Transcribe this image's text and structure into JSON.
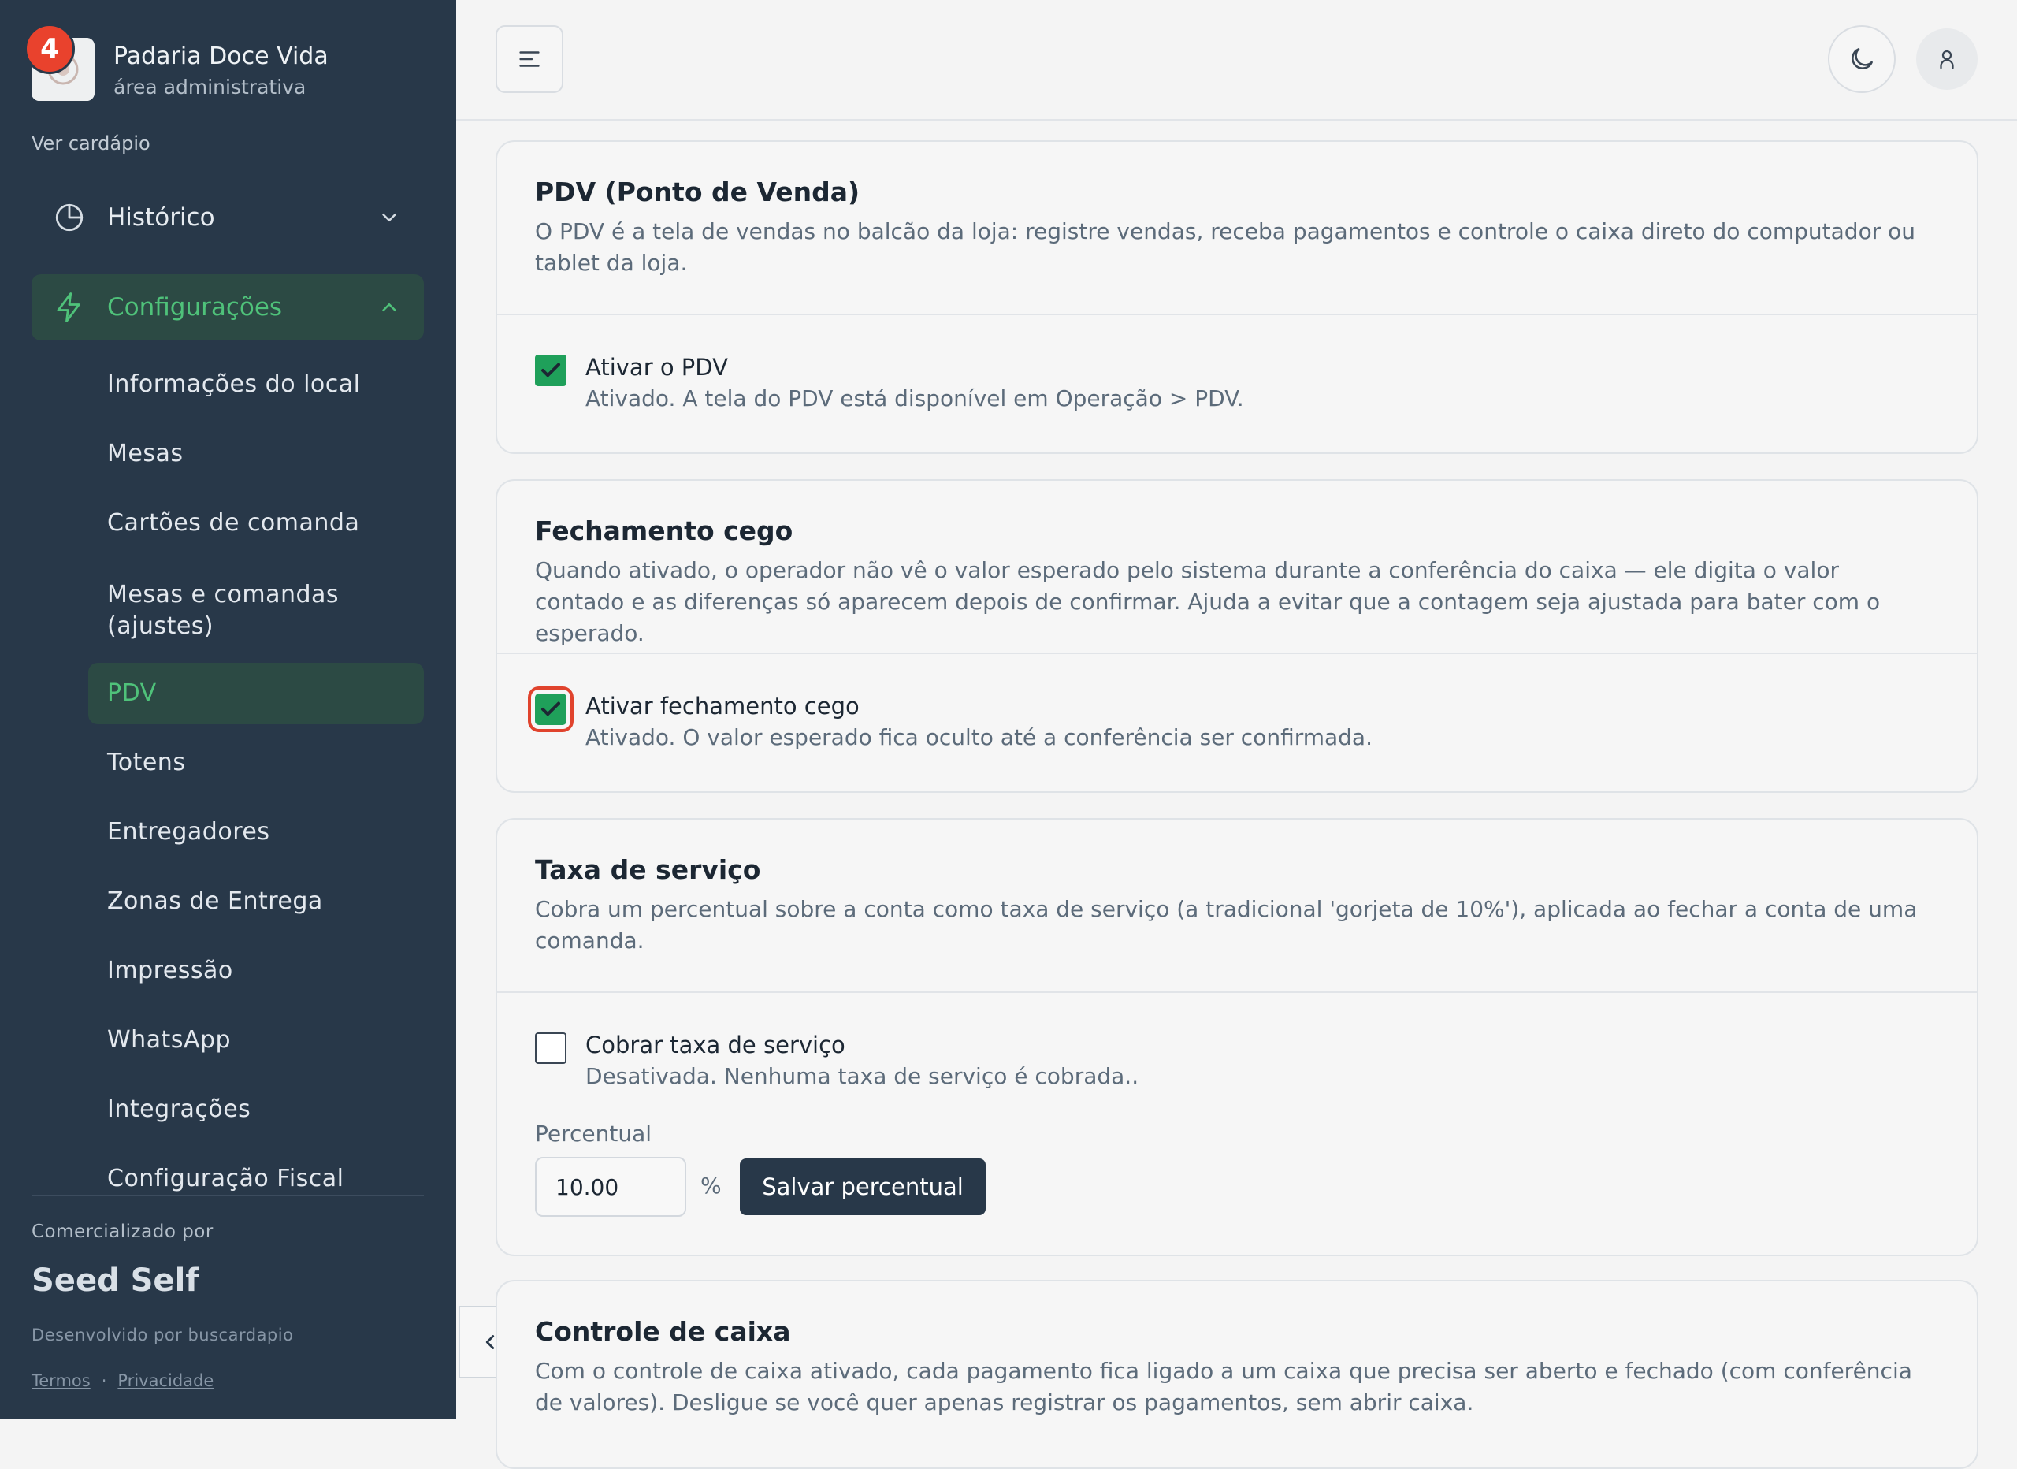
{
  "sidebar": {
    "brand_name": "Padaria Doce Vida",
    "brand_subtitle": "área administrativa",
    "notification_count": "4",
    "view_menu_link": "Ver cardápio",
    "groups": {
      "history": "Histórico",
      "settings": "Configurações"
    },
    "items": [
      "Informações do local",
      "Mesas",
      "Cartões de comanda",
      "Mesas e comandas (ajustes)",
      "PDV",
      "Totens",
      "Entregadores",
      "Zonas de Entrega",
      "Impressão",
      "WhatsApp",
      "Integrações",
      "Configuração Fiscal"
    ],
    "active_item": "PDV",
    "powered_by": "Comercializado por",
    "product": "Seed Self",
    "developed_by": "Desenvolvido por buscardapio",
    "terms": "Termos",
    "separator": "·",
    "privacy": "Privacidade"
  },
  "cards": {
    "pdv": {
      "title": "PDV (Ponto de Venda)",
      "description": "O PDV é a tela de vendas no balcão da loja: registre vendas, receba pagamentos e controle o caixa direto do computador ou tablet da loja.",
      "option_label": "Ativar o PDV",
      "option_desc": "Ativado. A tela do PDV está disponível em Operação > PDV.",
      "checked": true
    },
    "blind": {
      "title": "Fechamento cego",
      "description": "Quando ativado, o operador não vê o valor esperado pelo sistema durante a conferência do caixa — ele digita o valor contado e as diferenças só aparecem depois de confirmar. Ajuda a evitar que a contagem seja ajustada para bater com o esperado.",
      "option_label": "Ativar fechamento cego",
      "option_desc": "Ativado. O valor esperado fica oculto até a conferência ser confirmada.",
      "checked": true
    },
    "service": {
      "title": "Taxa de serviço",
      "description": "Cobra um percentual sobre a conta como taxa de serviço (a tradicional 'gorjeta de 10%'), aplicada ao fechar a conta de uma comanda.",
      "option_label": "Cobrar taxa de serviço",
      "option_desc": "Desativada. Nenhuma taxa de serviço é cobrada..",
      "checked": false,
      "percent_label": "Percentual",
      "percent_value": "10.00",
      "percent_sign": "%",
      "save_label": "Salvar percentual"
    },
    "cash": {
      "title": "Controle de caixa",
      "description": "Com o controle de caixa ativado, cada pagamento fica ligado a um caixa que precisa ser aberto e fechado (com conferência de valores). Desligue se você quer apenas registrar os pagamentos, sem abrir caixa."
    }
  },
  "colors": {
    "sidebar_bg": "#283849",
    "accent": "#1fa05a",
    "active_text": "#4fc27a",
    "badge": "#e9422d"
  }
}
